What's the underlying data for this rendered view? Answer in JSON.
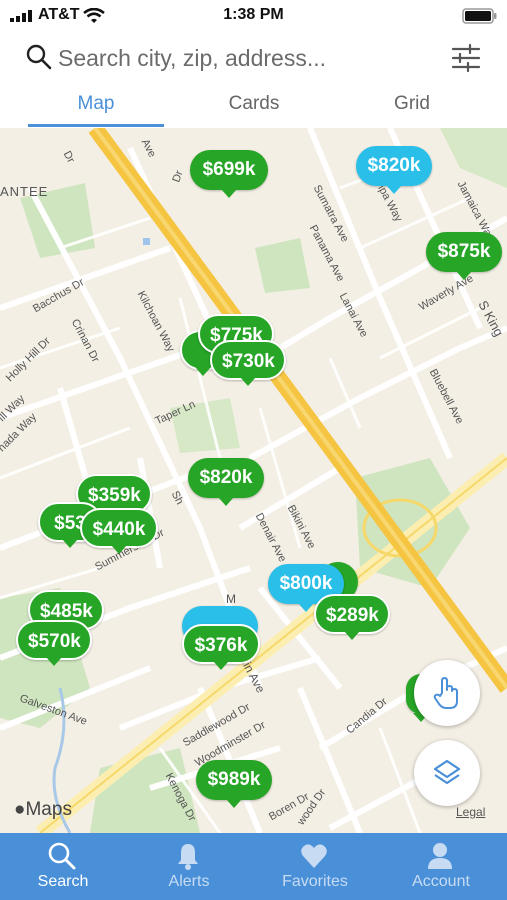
{
  "status_bar": {
    "carrier": "AT&T",
    "time": "1:38 PM"
  },
  "search": {
    "placeholder": "Search city, zip, address..."
  },
  "tabs": [
    {
      "label": "Map"
    },
    {
      "label": "Cards"
    },
    {
      "label": "Grid"
    }
  ],
  "active_tab": "Map",
  "map": {
    "attribution": "Maps",
    "legal": "Legal",
    "streets": [
      "Dr",
      "Dr",
      "Ave",
      "Sumatra Ave",
      "Tampa Way",
      "Jamaica Way",
      "Panama Ave",
      "Lanai Ave",
      "Waverly Ave",
      "S King",
      "ANTEE",
      "Bacchus Dr",
      "Crinan Dr",
      "Holly Hill Dr",
      "Kilchoan Way",
      "Taper Ln",
      "Bluebell Ave",
      "Ill Way",
      "nada Way",
      "Bikini Ave",
      "Denair Ave",
      "Sh",
      "Summerside Dr",
      "M",
      "hlin Ave",
      "Galveston Ave",
      "Saddlewood Dr",
      "Woodminster Dr",
      "Kenoga Dr",
      "Candia Dr",
      "Boren Dr",
      "wood Dr"
    ],
    "listings": [
      {
        "price": "$699k",
        "status": "green"
      },
      {
        "price": "$820k",
        "status": "blue"
      },
      {
        "price": "$875k",
        "status": "green"
      },
      {
        "price": "$775k",
        "status": "green"
      },
      {
        "price": "$730k",
        "status": "green"
      },
      {
        "price": "$820k",
        "status": "green"
      },
      {
        "price": "$359k",
        "status": "green"
      },
      {
        "price": "$53",
        "status": "green"
      },
      {
        "price": "$440k",
        "status": "green"
      },
      {
        "price": "$800k",
        "status": "blue"
      },
      {
        "price": "$289k",
        "status": "green"
      },
      {
        "price": "$485k",
        "status": "green"
      },
      {
        "price": "$570k",
        "status": "green"
      },
      {
        "price": "$376k",
        "status": "green"
      },
      {
        "price": "$989k",
        "status": "green"
      }
    ]
  },
  "controls": {
    "draw_icon": "hand-pointer-icon",
    "layers_icon": "layers-icon"
  },
  "bottom_nav": [
    {
      "label": "Search",
      "icon": "search-icon",
      "active": true
    },
    {
      "label": "Alerts",
      "icon": "bell-icon",
      "active": false
    },
    {
      "label": "Favorites",
      "icon": "heart-icon",
      "active": false
    },
    {
      "label": "Account",
      "icon": "person-icon",
      "active": false
    }
  ],
  "colors": {
    "accent": "#4a90d9",
    "pin_green": "#27a527",
    "pin_blue": "#29bfe8",
    "highway": "#f5c542"
  }
}
